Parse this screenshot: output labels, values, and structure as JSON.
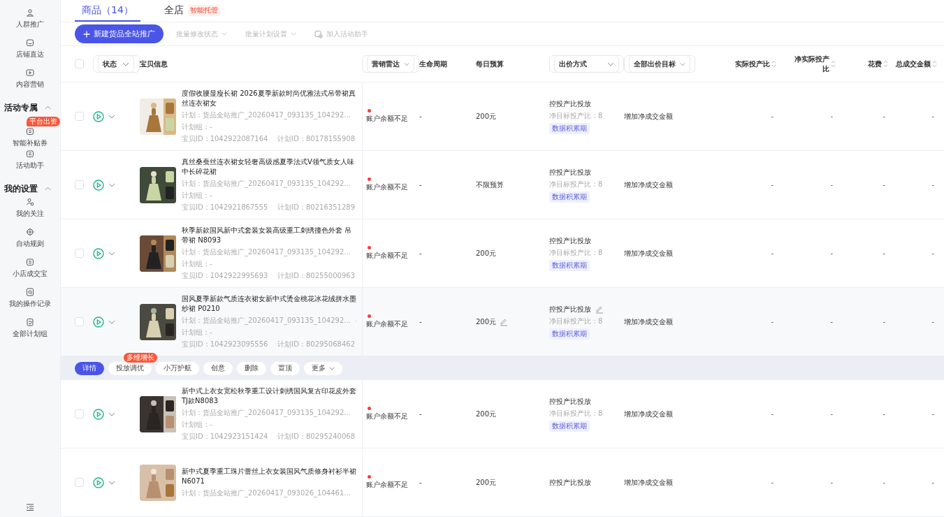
{
  "sidebar": {
    "items": [
      {
        "label": "人群推广"
      },
      {
        "label": "店铺直达"
      },
      {
        "label": "内容营销"
      }
    ],
    "sections": [
      {
        "title": "活动专属",
        "expanded": true,
        "items": [
          {
            "label": "智能补贴券",
            "badge": "平台出资"
          },
          {
            "label": "活动助手"
          }
        ]
      },
      {
        "title": "我的设置",
        "expanded": true,
        "items": [
          {
            "label": "我的关注"
          },
          {
            "label": "自动规则"
          },
          {
            "label": "小店成交宝"
          },
          {
            "label": "我的操作记录"
          },
          {
            "label": "全部计划组"
          }
        ]
      }
    ]
  },
  "select_all": {
    "checked": false
  },
  "tabs": [
    {
      "label": "商品（14）",
      "selected": true
    },
    {
      "label": "全店",
      "badge": "智能托管",
      "selected": false
    }
  ],
  "toolbar": [
    {
      "kind": "primary",
      "label": "新建货品全站推广"
    },
    {
      "kind": "dropdown",
      "label": "批量修改状态"
    },
    {
      "kind": "dropdown",
      "label": "批量计划设置"
    },
    {
      "kind": "helper",
      "label": "加入活动助手"
    }
  ],
  "columns": [
    {
      "kind": "filter",
      "label": "状态"
    },
    {
      "kind": "plain",
      "label": "宝贝信息"
    },
    {
      "kind": "filter",
      "label": "营销雷达"
    },
    {
      "kind": "plain",
      "label": "生命周期"
    },
    {
      "kind": "plain",
      "label": "每日预算"
    },
    {
      "kind": "filter",
      "label": "出价方式"
    },
    {
      "kind": "filter",
      "label": "全部出价目标"
    },
    {
      "kind": "sort",
      "label": "实际投产比"
    },
    {
      "kind": "sort",
      "label": "净实际投产比"
    },
    {
      "kind": "sort",
      "label": "花费"
    },
    {
      "kind": "sort",
      "label": "总成交金额"
    }
  ],
  "rows": [
    {
      "hovered": false,
      "title": "度假收腰显瘦长裙 2026夏季新款时尚优雅法式吊带裙真丝连衣裙女",
      "plan": "计划：货品全站推广_20260417_093135_104292...",
      "plan_group": "计划组：-",
      "item_id": "宝贝ID：1042922087164",
      "plan_id": "计划ID：80178155908",
      "status": "账户余额不足",
      "lifecycle": "-",
      "budget": "200元",
      "bid_method": "控投产比投放",
      "bid_target": "净目标投产比：8",
      "tag": "数据积累期",
      "goal": "增加净成交金额",
      "metrics": [
        "-",
        "-",
        "-",
        "-"
      ]
    },
    {
      "hovered": false,
      "title": "真丝桑蚕丝连衣裙女轻奢高级感夏季法式V领气质女人味中长碎花裙",
      "plan": "计划：货品全站推广_20260417_093135_104292...",
      "plan_group": "计划组：-",
      "item_id": "宝贝ID：1042921867555",
      "plan_id": "计划ID：80216351289",
      "status": "账户余额不足",
      "lifecycle": "-",
      "budget": "不限预算",
      "bid_method": "控投产比投放",
      "bid_target": "净目标投产比：8",
      "tag": "数据积累期",
      "goal": "增加净成交金额",
      "metrics": [
        "-",
        "-",
        "-",
        "-"
      ]
    },
    {
      "hovered": false,
      "title": "秋季新款国风新中式套装女装高级重工刺绣撞色外套 吊带裙 N8093",
      "plan": "计划：货品全站推广_20260417_093135_104292...",
      "plan_group": "计划组：-",
      "item_id": "宝贝ID：1042922995693",
      "plan_id": "计划ID：80255000963",
      "status": "账户余额不足",
      "lifecycle": "-",
      "budget": "200元",
      "bid_method": "控投产比投放",
      "bid_target": "净目标投产比：8",
      "tag": "数据积累期",
      "goal": "增加净成交金额",
      "metrics": [
        "-",
        "-",
        "-",
        "-"
      ]
    },
    {
      "hovered": true,
      "title": "国风夏季新款气质连衣裙女新中式烫金桃花冰花绒拼水墨纱裙 P0210",
      "plan": "计划：货品全站推广_20260417_093135_104292...",
      "plan_group": "计划组：-",
      "item_id": "宝贝ID：1042923095556",
      "plan_id": "计划ID：80295068462",
      "status": "账户余额不足",
      "lifecycle": "-",
      "budget": "200元",
      "bid_method": "控投产比投放",
      "bid_target": "净目标投产比：8",
      "tag": "数据积累期",
      "goal": "增加净成交金额",
      "metrics": [
        "-",
        "-",
        "-",
        "-"
      ],
      "actions": [
        {
          "label": "详情",
          "selected": true
        },
        {
          "label": "投放调优",
          "badge": "多维增长",
          "selected": false
        },
        {
          "label": "小万护航",
          "selected": false
        },
        {
          "label": "创意",
          "selected": false
        },
        {
          "label": "删除",
          "selected": false
        },
        {
          "label": "置顶",
          "selected": false
        },
        {
          "label": "更多",
          "kind": "menu",
          "selected": false
        }
      ]
    },
    {
      "hovered": false,
      "title": "新中式上衣女宽松秋季重工设计刺绣国风复古印花皮外套TJ款N8083",
      "plan": "计划：货品全站推广_20260417_093135_104292...",
      "plan_group": "计划组：-",
      "item_id": "宝贝ID：1042923151424",
      "plan_id": "计划ID：80295240068",
      "status": "账户余额不足",
      "lifecycle": "-",
      "budget": "200元",
      "bid_method": "控投产比投放",
      "bid_target": "净目标投产比：8",
      "tag": "数据积累期",
      "goal": "增加净成交金额",
      "metrics": [
        "-",
        "-",
        "-",
        "-"
      ]
    },
    {
      "hovered": false,
      "title": "新中式夏季重工珠片蕾丝上衣女装国风气质修身衬衫半裙N6071",
      "plan": "计划：货品全站推广_20260417_093026_104461...",
      "status": "账户余额不足",
      "lifecycle": "-",
      "budget": "200元",
      "bid_method": "控投产比投放",
      "goal": "增加净成交金额",
      "metrics": [
        "-",
        "-",
        "-",
        "-"
      ]
    }
  ]
}
